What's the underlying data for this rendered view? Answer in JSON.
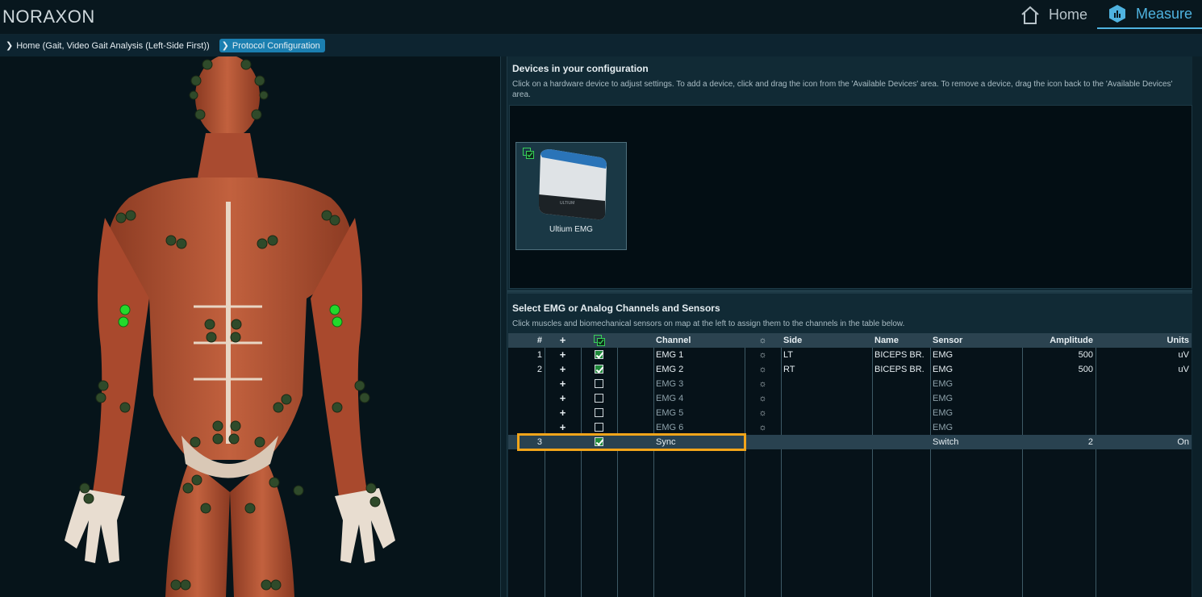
{
  "app": {
    "logo": "NORAXON"
  },
  "nav": {
    "home_label": "Home",
    "measure_label": "Measure"
  },
  "breadcrumb": {
    "home": "Home (Gait, Video Gait Analysis (Left-Side First))",
    "current": "Protocol Configuration"
  },
  "devices": {
    "title": "Devices in your configuration",
    "description": "Click on a hardware device to adjust settings. To add a device, click and drag the icon from the 'Available Devices' area. To remove a device, drag the icon back to the 'Available Devices' area.",
    "items": [
      {
        "label": "Ultium EMG"
      }
    ]
  },
  "channels": {
    "title": "Select EMG or Analog Channels and Sensors",
    "description": "Click muscles and biomechanical sensors on map at the left to assign them to the channels in the table below.",
    "headers": {
      "num": "#",
      "plus": "+",
      "channel": "Channel",
      "side": "Side",
      "name": "Name",
      "sensor": "Sensor",
      "amplitude": "Amplitude",
      "units": "Units"
    },
    "rows": [
      {
        "num": "1",
        "plus": "+",
        "checked": true,
        "channel": "EMG 1",
        "side": "LT",
        "name": "BICEPS BR.",
        "sensor": "EMG",
        "amplitude": "500",
        "units": "uV"
      },
      {
        "num": "2",
        "plus": "+",
        "checked": true,
        "channel": "EMG 2",
        "side": "RT",
        "name": "BICEPS BR.",
        "sensor": "EMG",
        "amplitude": "500",
        "units": "uV"
      },
      {
        "num": "",
        "plus": "+",
        "checked": false,
        "channel": "EMG 3",
        "side": "",
        "name": "",
        "sensor": "EMG",
        "amplitude": "",
        "units": ""
      },
      {
        "num": "",
        "plus": "+",
        "checked": false,
        "channel": "EMG 4",
        "side": "",
        "name": "",
        "sensor": "EMG",
        "amplitude": "",
        "units": ""
      },
      {
        "num": "",
        "plus": "+",
        "checked": false,
        "channel": "EMG 5",
        "side": "",
        "name": "",
        "sensor": "EMG",
        "amplitude": "",
        "units": ""
      },
      {
        "num": "",
        "plus": "+",
        "checked": false,
        "channel": "EMG 6",
        "side": "",
        "name": "",
        "sensor": "EMG",
        "amplitude": "",
        "units": ""
      },
      {
        "num": "3",
        "plus": "",
        "checked": true,
        "channel": "Sync",
        "side": "",
        "name": "",
        "sensor": "Switch",
        "amplitude": "2",
        "units": "On"
      }
    ]
  },
  "colors": {
    "accent": "#4fb3e0",
    "highlight": "#f2a51a",
    "sensor_active": "#22d92b",
    "sensor_inactive": "#2f4a2a"
  }
}
